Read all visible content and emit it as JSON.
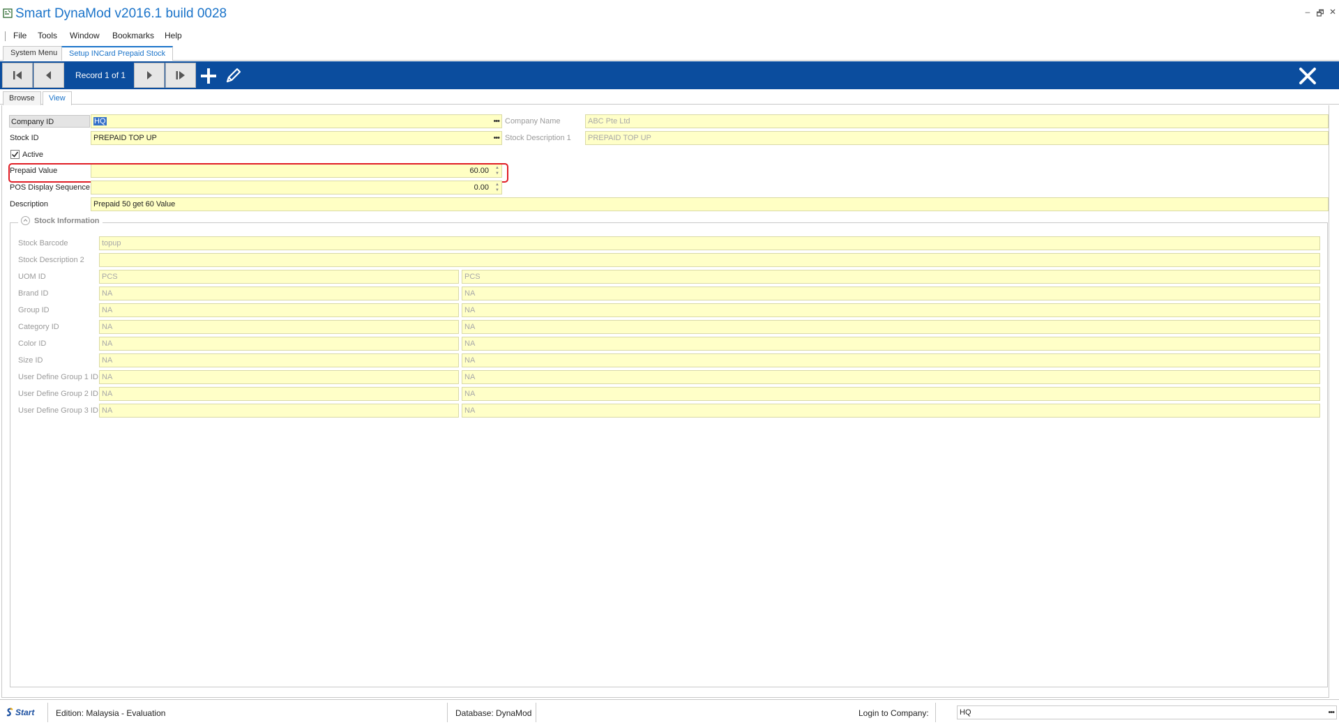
{
  "window": {
    "title": "Smart DynaMod v2016.1 build 0028",
    "controls": {
      "minimize": "–",
      "restore": "🗗",
      "close": "✕"
    }
  },
  "menu": [
    "File",
    "Tools",
    "Window",
    "Bookmarks",
    "Help"
  ],
  "doc_tabs": [
    {
      "label": "System Menu",
      "active": false
    },
    {
      "label": "Setup INCard Prepaid Stock",
      "active": true
    }
  ],
  "toolbar": {
    "record_label": "Record 1 of 1",
    "bg_color": "#0b4d9e"
  },
  "view_tabs": [
    {
      "label": "Browse",
      "active": false
    },
    {
      "label": "View",
      "active": true
    }
  ],
  "form": {
    "company_id": {
      "label": "Company ID",
      "value": "HQ"
    },
    "company_name": {
      "label": "Company Name",
      "value": "ABC Pte Ltd"
    },
    "stock_id": {
      "label": "Stock ID",
      "value": "PREPAID TOP UP"
    },
    "stock_description_1": {
      "label": "Stock Description 1",
      "value": "PREPAID TOP UP"
    },
    "active": {
      "label": "Active",
      "checked": true
    },
    "prepaid_value": {
      "label": "Prepaid Value",
      "value": "60.00"
    },
    "pos_display_sequence": {
      "label": "POS Display Sequence",
      "value": "0.00"
    },
    "description": {
      "label": "Description",
      "value": "Prepaid 50 get 60 Value"
    }
  },
  "stock_information": {
    "title": "Stock Information",
    "stock_barcode": {
      "label": "Stock Barcode",
      "value": "topup"
    },
    "stock_description_2": {
      "label": "Stock Description 2",
      "value": ""
    },
    "rows": [
      {
        "label": "UOM ID",
        "id": "PCS",
        "name": "PCS"
      },
      {
        "label": "Brand ID",
        "id": "NA",
        "name": "NA"
      },
      {
        "label": "Group ID",
        "id": "NA",
        "name": "NA"
      },
      {
        "label": "Category ID",
        "id": "NA",
        "name": "NA"
      },
      {
        "label": "Color ID",
        "id": "NA",
        "name": "NA"
      },
      {
        "label": "Size ID",
        "id": "NA",
        "name": "NA"
      },
      {
        "label": "User Define Group 1 ID",
        "id": "NA",
        "name": "NA"
      },
      {
        "label": "User Define Group 2 ID",
        "id": "NA",
        "name": "NA"
      },
      {
        "label": "User Define Group 3 ID",
        "id": "NA",
        "name": "NA"
      }
    ]
  },
  "status_bar": {
    "logo": "Start",
    "edition": "Edition: Malaysia - Evaluation",
    "database": "Database: DynaMod",
    "login_label": "Login to Company:",
    "login_value": "HQ"
  },
  "colors": {
    "field_bg": "#ffffc4",
    "accent": "#1a73c9",
    "highlight": "#e01c24"
  }
}
